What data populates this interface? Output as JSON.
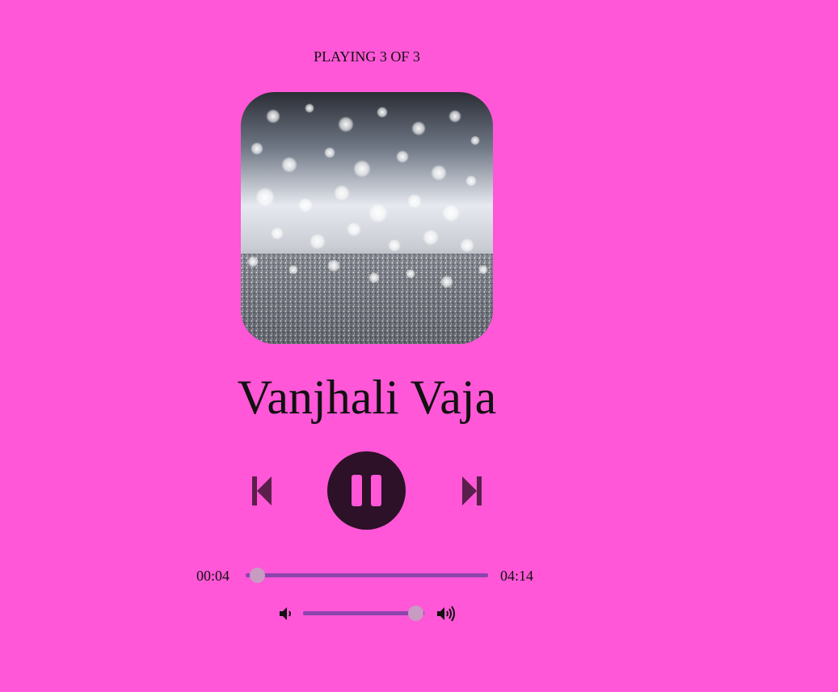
{
  "player": {
    "status_text": "PLAYING 3 OF 3",
    "track_title": "Vanjhali Vaja",
    "current_time": "00:04",
    "total_time": "04:14",
    "progress_fraction": 0.04,
    "volume_fraction": 0.93,
    "play_state": "playing",
    "icons": {
      "prev": "skip-previous-icon",
      "playpause": "pause-icon",
      "next": "skip-next-icon",
      "volume_low": "volume-low-icon",
      "volume_high": "volume-high-icon"
    },
    "artwork": "silver-glitter-bokeh"
  },
  "colors": {
    "background": "#ff57d7",
    "button_dark": "#2d1128",
    "icon": "#5b1f4b",
    "slider_track": "#8e44ad",
    "slider_thumb": "#c89bc3"
  }
}
